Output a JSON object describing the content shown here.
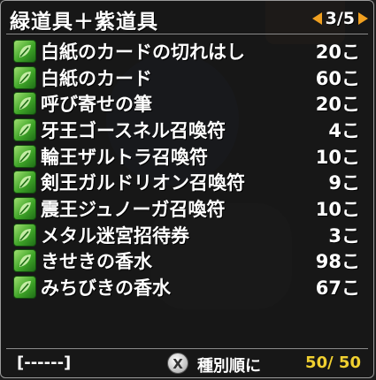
{
  "header": {
    "title": "緑道具＋紫道具",
    "page_label": "3/5"
  },
  "items": [
    {
      "name": "白紙のカードの切れはし",
      "qty": "20こ",
      "icon": "green-leaf-icon"
    },
    {
      "name": "白紙のカード",
      "qty": "60こ",
      "icon": "green-leaf-icon"
    },
    {
      "name": "呼び寄せの筆",
      "qty": "20こ",
      "icon": "green-leaf-icon"
    },
    {
      "name": "牙王ゴースネル召喚符",
      "qty": "4こ",
      "icon": "green-leaf-icon"
    },
    {
      "name": "輪王ザルトラ召喚符",
      "qty": "10こ",
      "icon": "green-leaf-icon"
    },
    {
      "name": "剣王ガルドリオン召喚符",
      "qty": "9こ",
      "icon": "green-leaf-icon"
    },
    {
      "name": "震王ジュノーガ召喚符",
      "qty": "10こ",
      "icon": "green-leaf-icon"
    },
    {
      "name": "メタル迷宮招待券",
      "qty": "3こ",
      "icon": "green-leaf-icon"
    },
    {
      "name": "きせきの香水",
      "qty": "98こ",
      "icon": "green-leaf-icon"
    },
    {
      "name": "みちびきの香水",
      "qty": "67こ",
      "icon": "green-leaf-icon"
    }
  ],
  "footer": {
    "slot_label": "[------]",
    "button_glyph": "X",
    "sort_label": "種別順に",
    "count_label": "50/ 50"
  },
  "colors": {
    "accent_arrow": "#f0a020",
    "count_yellow": "#f0d030",
    "leaf_green": "#3fa528"
  }
}
